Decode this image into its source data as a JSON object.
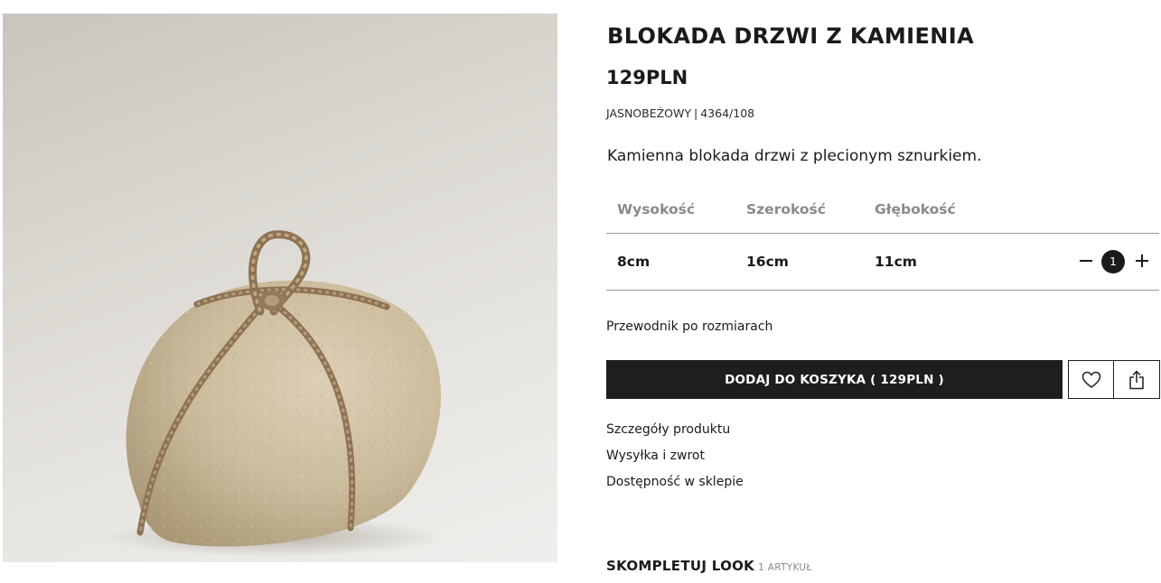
{
  "product": {
    "image_alt": "Kamienna blokada drzwi z plecionym sznurkiem",
    "title": "BLOKADA DRZWI Z KAMIENIA",
    "price": "129PLN",
    "color": "JASNOBEŻOWY",
    "separator": "|",
    "reference": "4364/108",
    "description": "Kamienna blokada drzwi z plecionym sznurkiem."
  },
  "dimensions": {
    "headers": [
      "Wysokość",
      "Szerokość",
      "Głębokość"
    ],
    "values": [
      "8cm",
      "16cm",
      "11cm"
    ]
  },
  "quantity": {
    "value": "1",
    "decrement_icon": "minus-icon",
    "increment_icon": "plus-icon"
  },
  "size_guide_label": "Przewodnik po rozmiarach",
  "add_to_cart_label": "DODAJ DO KOSZYKA ( 129PLN )",
  "icons": {
    "wishlist": "heart-icon",
    "share": "share-icon"
  },
  "info_links": [
    "Szczegóły produktu",
    "Wysyłka i zwrot",
    "Dostępność w sklepie"
  ],
  "look": {
    "title": "SKOMPLETUJ LOOK",
    "count": "1 ARTYKUŁ"
  },
  "colors": {
    "button_background": "#1e1e1e",
    "muted_text": "#8a8a8a",
    "stone": "#c9b99a",
    "rope": "#9e8566",
    "background_top": "#c9c5be",
    "background_bottom": "#efeeec"
  }
}
